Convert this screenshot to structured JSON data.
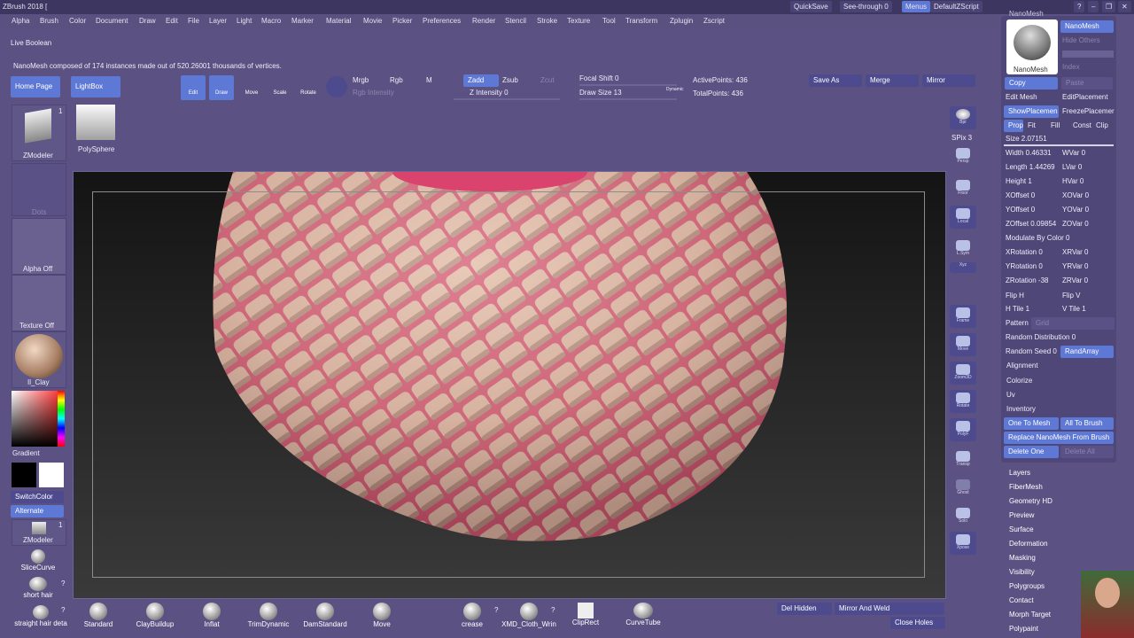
{
  "titlebar": {
    "title": "ZBrush 2018 [",
    "quicksave": "QuickSave",
    "see_through": "See-through  0",
    "menus": "Menus",
    "script": "DefaultZScript"
  },
  "menubar": [
    "Alpha",
    "Brush",
    "Color",
    "Document",
    "Draw",
    "Edit",
    "File",
    "Layer",
    "Light",
    "Macro",
    "Marker",
    "Material",
    "Movie",
    "Picker",
    "Preferences",
    "Render",
    "Stencil",
    "Stroke",
    "Texture",
    "Tool",
    "Transform",
    "Zplugin",
    "Zscript"
  ],
  "top": {
    "live_boolean": "Live Boolean",
    "status": "NanoMesh composed of 174 instances made out of 520.26001 thousands of vertices.",
    "home_page": "Home Page",
    "lightbox": "LightBox",
    "mrgb": "Mrgb",
    "rgb": "Rgb",
    "m": "M",
    "zadd": "Zadd",
    "zsub": "Zsub",
    "zcut": "Zcut",
    "rgb_intensity": "Rgb Intensity",
    "z_intensity": "Z Intensity 0",
    "focal_shift": "Focal Shift 0",
    "draw_size": "Draw Size 13",
    "dynamic": "Dynamic",
    "active_points": "ActivePoints: 436",
    "total_points": "TotalPoints: 436",
    "save_as": "Save As",
    "merge": "Merge",
    "mirror": "Mirror",
    "edit": "Edit",
    "draw": "Draw",
    "move": "Move",
    "scale": "Scale",
    "rotate": "Rotate"
  },
  "left": {
    "zmodeler": "ZModeler",
    "polysphere": "PolySphere",
    "dots": "Dots",
    "alpha_off": "Alpha Off",
    "texture_off": "Texture Off",
    "material": "Il_Clay",
    "gradient": "Gradient",
    "switch_color": "SwitchColor",
    "alternate": "Alternate",
    "zmodeler2": "ZModeler",
    "slice_curve": "SliceCurve",
    "short_hair": "short hair",
    "straight_hair": "straight hair deta",
    "count1": "1",
    "count2": "1",
    "colors": {
      "main": "#ff2020",
      "secondary": "#000000",
      "white": "#ffffff"
    }
  },
  "right_shelf": [
    "Bpr",
    "SPix 3",
    "Persp",
    "Floor",
    "Local",
    "L.Sym",
    "Xyz",
    "Frame",
    "Move",
    "Zoom3D",
    "Rotate",
    "PolyF",
    "Transp",
    "Ghost",
    "Solo",
    "Xpose"
  ],
  "panel": {
    "nanomesh_label": "NanoMesh",
    "thumb_label": "NanoMesh",
    "hide_others": "Hide Others",
    "index": "Index",
    "copy": "Copy",
    "paste": "Paste",
    "edit_mesh": "Edit Mesh",
    "edit_placement": "EditPlacement",
    "show_placement": "ShowPlacemen",
    "freeze_placement": "FreezePlacemer",
    "prop": "Prop",
    "fit": "Fit",
    "fill": "Fill",
    "const": "Const",
    "clip": "Clip",
    "size": "Size 2.07151",
    "width": "Width 0.46331",
    "wvar": "WVar 0",
    "length": "Length 1.44269",
    "lvar": "LVar 0",
    "height": "Height 1",
    "hvar": "HVar 0",
    "xoffset": "XOffset 0",
    "xovar": "XOVar 0",
    "yoffset": "YOffset 0",
    "yovar": "YOVar 0",
    "zoffset": "ZOffset 0.09854",
    "zovar": "ZOVar 0",
    "modulate": "Modulate By Color 0",
    "xrot": "XRotation 0",
    "xrvar": "XRVar 0",
    "yrot": "YRotation 0",
    "yrvar": "YRVar 0",
    "zrot": "ZRotation -38",
    "zrvar": "ZRVar 0",
    "flip_h": "Flip H",
    "flip_v": "Flip V",
    "htile": "H Tile 1",
    "vtile": "V Tile 1",
    "pattern": "Pattern",
    "grid": "Grid",
    "random_dist": "Random Distribution 0",
    "random_seed": "Random Seed 0",
    "randarray": "RandArray",
    "alignment": "Alignment",
    "colorize": "Colorize",
    "uv": "Uv",
    "inventory": "Inventory",
    "one_to_mesh": "One To Mesh",
    "all_to_brush": "All To Brush",
    "replace": "Replace NanoMesh From Brush",
    "delete_one": "Delete One",
    "delete_all": "Delete All"
  },
  "subpalettes": [
    "Layers",
    "FiberMesh",
    "Geometry HD",
    "Preview",
    "Surface",
    "Deformation",
    "Masking",
    "Visibility",
    "Polygroups",
    "Contact",
    "Morph Target",
    "Polypaint"
  ],
  "bottom_brushes": [
    "Standard",
    "ClayBuildup",
    "Inflat",
    "TrimDynamic",
    "DamStandard",
    "Move",
    "crease",
    "XMD_Cloth_Wrin",
    "ClipRect",
    "CurveTube"
  ],
  "bottom_right": {
    "del_hidden": "Del Hidden",
    "mirror_weld": "Mirror And Weld",
    "close_holes": "Close Holes"
  },
  "question_marks": [
    "?",
    "?",
    "?",
    "?"
  ]
}
